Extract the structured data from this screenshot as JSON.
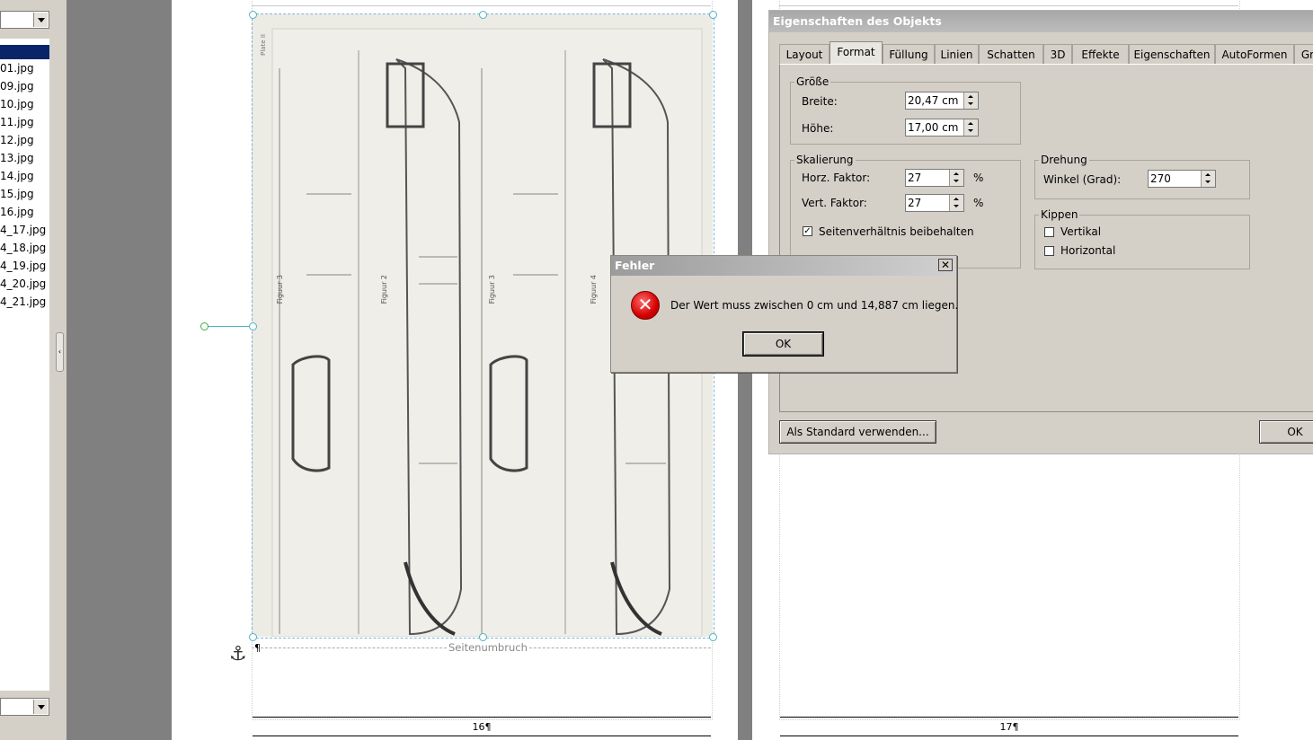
{
  "left_panel": {
    "files": [
      "01.jpg",
      "09.jpg",
      "10.jpg",
      "11.jpg",
      "12.jpg",
      "13.jpg",
      "14.jpg",
      "15.jpg",
      "16.jpg",
      "4_17.jpg",
      "4_18.jpg",
      "4_19.jpg",
      "4_20.jpg",
      "4_21.jpg"
    ]
  },
  "document": {
    "page_break_label": "Seitenumbruch",
    "page_number_left": "16¶",
    "page_number_right": "17¶",
    "paragraph_mark": "¶",
    "anchor_glyph": "⚓"
  },
  "image": {
    "plate_label": "Plate II",
    "figure_labels": [
      "Figuur 3",
      "Figuur 2",
      "Figuur 3",
      "Figuur 4"
    ]
  },
  "properties_dialog": {
    "title": "Eigenschaften des Objekts",
    "tabs": [
      "Layout",
      "Format",
      "Füllung",
      "Linien",
      "Schatten",
      "3D",
      "Effekte",
      "Eigenschaften",
      "AutoFormen",
      "Gr"
    ],
    "active_tab": "Format",
    "groups": {
      "size": "Größe",
      "scaling": "Skalierung",
      "rotation": "Drehung",
      "flip": "Kippen"
    },
    "width_label": "Breite:",
    "width_value": "20,47 cm",
    "height_label": "Höhe:",
    "height_value": "17,00 cm",
    "horz_label": "Horz. Faktor:",
    "horz_value": "27",
    "vert_label": "Vert. Faktor:",
    "vert_value": "27",
    "percent": "%",
    "keep_ratio_label": "Seitenverhältnis beibehalten",
    "keep_ratio_checked": true,
    "angle_label": "Winkel (Grad):",
    "angle_value": "270",
    "flip_vertical_label": "Vertikal",
    "flip_horizontal_label": "Horizontal",
    "default_button": "Als Standard verwenden...",
    "ok_button": "OK"
  },
  "error_dialog": {
    "title": "Fehler",
    "message": "Der Wert muss zwischen 0 cm und 14,887 cm liegen.",
    "ok_button": "OK",
    "close_glyph": "✕",
    "icon_glyph": "✕"
  },
  "colors": {
    "selection_bar": "#0a246a",
    "handle_border": "#4bb3c9",
    "error_red": "#d40000",
    "dialog_bg": "#d4d0c8"
  }
}
